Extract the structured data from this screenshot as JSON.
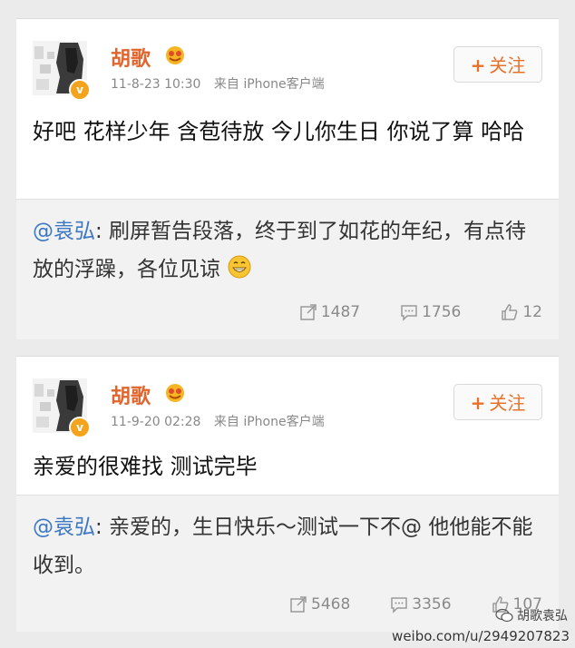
{
  "posts": [
    {
      "username": "胡歌",
      "time": "11-8-23 10:30",
      "source": "来自 iPhone客户端",
      "follow_label": "关注",
      "text": "好吧 花样少年 含苞待放 今儿你生日 你说了算 哈哈",
      "repost": {
        "mention": "@袁弘",
        "text": ": 刷屏暂告段落，终于到了如花的年纪，有点待放的浮躁，各位见谅"
      },
      "stats": {
        "reposts": "1487",
        "comments": "1756",
        "likes": "12"
      }
    },
    {
      "username": "胡歌",
      "time": "11-9-20 02:28",
      "source": "来自 iPhone客户端",
      "follow_label": "关注",
      "text": "亲爱的很难找 测试完毕",
      "repost": {
        "mention": "@袁弘",
        "text": ": 亲爱的，生日快乐～测试一下不@ 他他能不能收到。"
      },
      "stats": {
        "reposts": "5468",
        "comments": "3356",
        "likes": "107"
      }
    }
  ],
  "watermark": {
    "url": "weibo.com/u/2949207823",
    "wechat": "胡歌袁弘"
  },
  "colors": {
    "username": "#e0642c",
    "mention": "#3d78c4",
    "follow": "#e8712a",
    "verified": "#f4a31c"
  }
}
